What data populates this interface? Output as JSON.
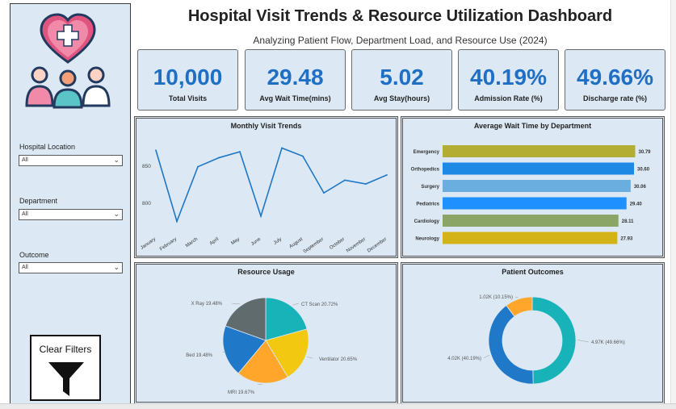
{
  "header": {
    "title": "Hospital Visit Trends & Resource Utilization Dashboard",
    "subtitle": "Analyzing Patient Flow, Department Load, and Resource Use (2024)"
  },
  "kpis": [
    {
      "value": "10,000",
      "label": "Total Visits"
    },
    {
      "value": "29.48",
      "label": "Avg Wait Time(mins)"
    },
    {
      "value": "5.02",
      "label": "Avg Stay(hours)"
    },
    {
      "value": "40.19%",
      "label": "Admission Rate (%)"
    },
    {
      "value": "49.66%",
      "label": "Discharge rate (%)"
    }
  ],
  "filters": [
    {
      "label": "Hospital Location",
      "value": "All"
    },
    {
      "label": "Department",
      "value": "All"
    },
    {
      "label": "Outcome",
      "value": "All"
    }
  ],
  "clear_button": {
    "label": "Clear Filters"
  },
  "colors": {
    "accent": "#1f6fc5",
    "panel_bg": "#dce9f5",
    "line": "#1f77c4"
  },
  "icons": {
    "logo": "people-heart-logo",
    "clear": "funnel-icon",
    "dropdown": "chevron-down-icon"
  },
  "chart_data": [
    {
      "type": "line",
      "title": "Monthly Visit Trends",
      "categories": [
        "January",
        "February",
        "March",
        "April",
        "May",
        "June",
        "July",
        "August",
        "September",
        "October",
        "November",
        "December"
      ],
      "values": [
        870,
        775,
        848,
        860,
        868,
        782,
        873,
        862,
        813,
        830,
        825,
        837
      ],
      "ylim": [
        770,
        880
      ],
      "yticks": [
        800,
        850
      ]
    },
    {
      "type": "bar",
      "orientation": "horizontal",
      "title": "Average Wait Time by Department",
      "categories": [
        "Emergency",
        "Orthopedics",
        "Surgery",
        "Pediatrics",
        "Cardiology",
        "Neurology"
      ],
      "values": [
        30.79,
        30.6,
        30.06,
        29.4,
        28.11,
        27.93
      ],
      "labels": [
        "30.79",
        "30.60",
        "30.06",
        "29.40",
        "28.11",
        "27.93"
      ],
      "colors": [
        "#b3ae33",
        "#1e88e5",
        "#6aaee0",
        "#1e90ff",
        "#8aa566",
        "#d4b318"
      ]
    },
    {
      "type": "pie",
      "title": "Resource Usage",
      "slices": [
        {
          "name": "CT Scan",
          "label": "CT Scan 20.72%",
          "value": 20.72,
          "color": "#17b3b8"
        },
        {
          "name": "Ventilator",
          "label": "Ventilator 20.65%",
          "value": 20.65,
          "color": "#f2c811"
        },
        {
          "name": "MRI",
          "label": "MRI 19.67%",
          "value": 19.67,
          "color": "#ffa62b"
        },
        {
          "name": "Bed",
          "label": "Bed 19.48%",
          "value": 19.48,
          "color": "#1f78c8"
        },
        {
          "name": "X Ray",
          "label": "X Ray 19.48%",
          "value": 19.48,
          "color": "#5f6b6d"
        }
      ]
    },
    {
      "type": "pie",
      "donut": true,
      "title": "Patient Outcomes",
      "slices": [
        {
          "label": "4.97K (49.66%)",
          "value": 49.66,
          "color": "#17b3b8"
        },
        {
          "label": "4.02K (40.19%)",
          "value": 40.19,
          "color": "#1f78c8"
        },
        {
          "label": "1.02K (10.15%)",
          "value": 10.15,
          "color": "#ffa62b"
        }
      ]
    }
  ]
}
